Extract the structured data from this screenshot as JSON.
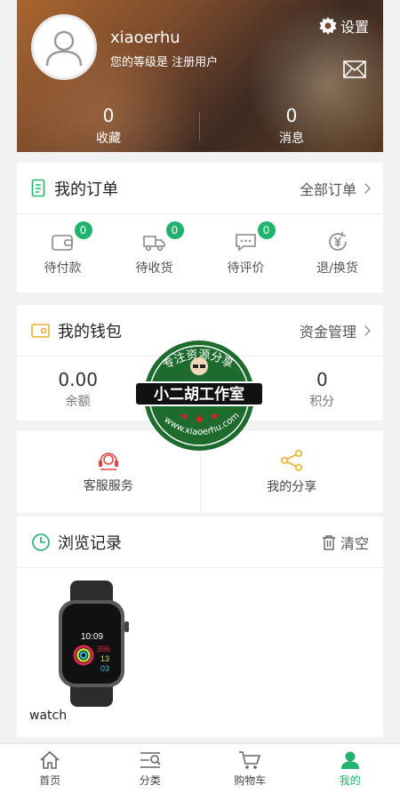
{
  "header": {
    "username": "xiaoerhu",
    "level_text": "您的等级是 注册用户",
    "settings_label": "设置",
    "stats": [
      {
        "value": "0",
        "label": "收藏"
      },
      {
        "value": "0",
        "label": "消息"
      }
    ]
  },
  "orders": {
    "title": "我的订单",
    "more_label": "全部订单",
    "items": [
      {
        "label": "待付款",
        "badge": "0",
        "icon": "wallet-icon"
      },
      {
        "label": "待收货",
        "badge": "0",
        "icon": "truck-icon"
      },
      {
        "label": "待评价",
        "badge": "0",
        "icon": "comment-icon"
      },
      {
        "label": "退/换货",
        "icon": "refund-icon"
      }
    ]
  },
  "wallet": {
    "title": "我的钱包",
    "more_label": "资金管理",
    "stats": [
      {
        "value": "0.00",
        "label": "余额"
      },
      {
        "value": "0",
        "label": "积分"
      }
    ]
  },
  "services": [
    {
      "label": "客服服务",
      "icon": "headset-icon"
    },
    {
      "label": "我的分享",
      "icon": "share-icon"
    }
  ],
  "watermark": {
    "top_text": "专注资源分享",
    "main_text": "小二胡工作室",
    "url_text": "www.xiaoerhu.com"
  },
  "history": {
    "title": "浏览记录",
    "clear_label": "清空",
    "product": {
      "name": "watch",
      "time": "10:09",
      "ring1": "396",
      "ring2": "13",
      "ring3": "03"
    }
  },
  "tabbar": [
    {
      "label": "首页",
      "icon": "home-icon"
    },
    {
      "label": "分类",
      "icon": "category-icon"
    },
    {
      "label": "购物车",
      "icon": "cart-icon"
    },
    {
      "label": "我的",
      "icon": "user-icon",
      "active": true
    }
  ],
  "colors": {
    "accent": "#21b36e",
    "gold": "#e8b030"
  }
}
